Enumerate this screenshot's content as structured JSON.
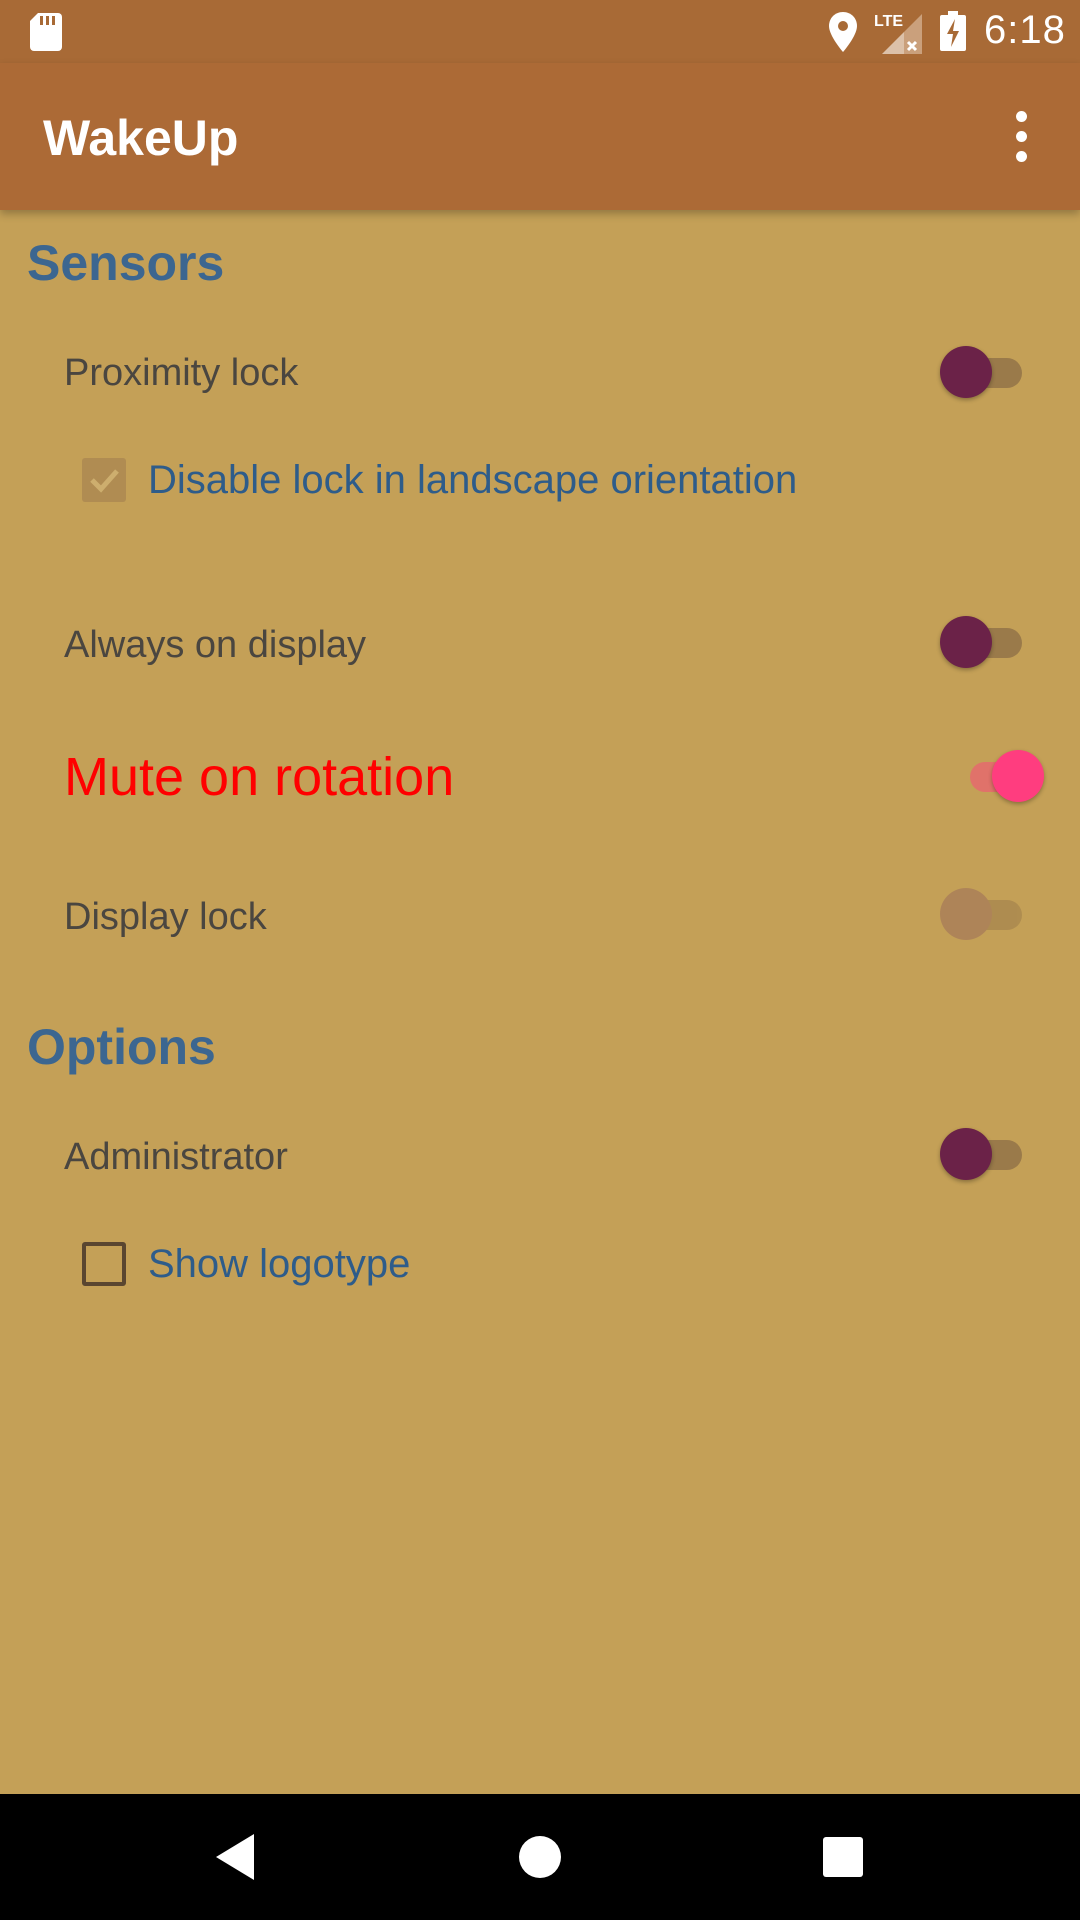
{
  "status_bar": {
    "time": "6:18",
    "network": "LTE",
    "icons": [
      "sd-card-icon",
      "location-icon",
      "lte-signal-icon",
      "battery-charging-icon"
    ]
  },
  "app_bar": {
    "title": "WakeUp",
    "overflow_icon": "more-vert-icon"
  },
  "sections": [
    {
      "title": "Sensors",
      "items": [
        {
          "type": "switch",
          "label": "Proximity lock",
          "on": false,
          "enabled": true
        },
        {
          "type": "checkbox",
          "label": "Disable lock in landscape orientation",
          "checked": true,
          "enabled": false
        },
        {
          "type": "switch",
          "label": "Always on display",
          "on": false,
          "enabled": true
        },
        {
          "type": "switch",
          "label": "Mute on rotation",
          "on": true,
          "enabled": true
        },
        {
          "type": "switch",
          "label": "Display lock",
          "on": false,
          "enabled": false
        }
      ]
    },
    {
      "title": "Options",
      "items": [
        {
          "type": "switch",
          "label": "Administrator",
          "on": false,
          "enabled": true
        },
        {
          "type": "checkbox",
          "label": "Show logotype",
          "checked": false,
          "enabled": true
        }
      ]
    }
  ],
  "colors": {
    "background": "#c4a057",
    "app_bar": "#ac6a36",
    "section_header": "#3c6690",
    "switch_thumb_off": "#6b2248",
    "switch_thumb_on": "#ff3d7f",
    "switch_track_on": "#e0726a",
    "switch_track_off": "#9a7a4a",
    "highlight_text": "#ff0000"
  },
  "nav_bar": {
    "icons": [
      "back-icon",
      "home-icon",
      "recents-icon"
    ]
  }
}
